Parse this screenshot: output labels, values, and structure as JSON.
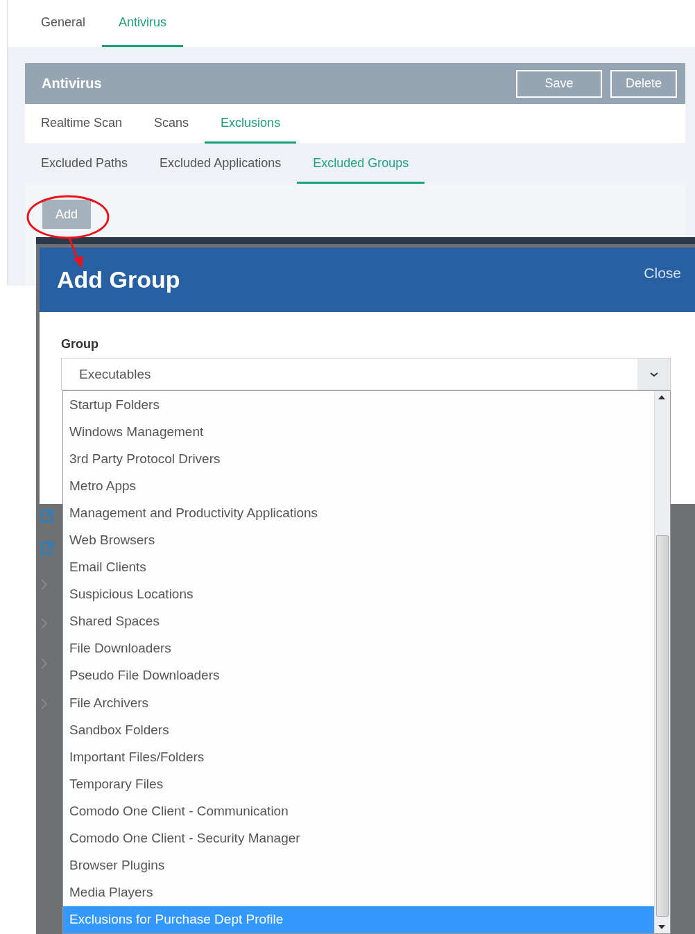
{
  "top_tabs": [
    {
      "label": "General",
      "selected": false
    },
    {
      "label": "Antivirus",
      "selected": true
    }
  ],
  "panel": {
    "title": "Antivirus",
    "buttons": [
      "Save",
      "Delete"
    ]
  },
  "sub_tabs": [
    {
      "label": "Realtime Scan",
      "selected": false
    },
    {
      "label": "Scans",
      "selected": false
    },
    {
      "label": "Exclusions",
      "selected": true
    }
  ],
  "exclusion_tabs": [
    {
      "label": "Excluded Paths",
      "selected": false
    },
    {
      "label": "Excluded Applications",
      "selected": false
    },
    {
      "label": "Excluded Groups",
      "selected": true
    }
  ],
  "add_button": "Add",
  "dialog": {
    "title": "Add Group",
    "close": "Close",
    "field_label": "Group",
    "select_value": "Executables",
    "options": [
      {
        "label": "Startup Folders",
        "selected": false
      },
      {
        "label": "Windows Management",
        "selected": false
      },
      {
        "label": "3rd Party Protocol Drivers",
        "selected": false
      },
      {
        "label": "Metro Apps",
        "selected": false
      },
      {
        "label": "Management and Productivity Applications",
        "selected": false
      },
      {
        "label": "Web Browsers",
        "selected": false
      },
      {
        "label": "Email Clients",
        "selected": false
      },
      {
        "label": "Suspicious Locations",
        "selected": false
      },
      {
        "label": "Shared Spaces",
        "selected": false
      },
      {
        "label": "File Downloaders",
        "selected": false
      },
      {
        "label": "Pseudo File Downloaders",
        "selected": false
      },
      {
        "label": "File Archivers",
        "selected": false
      },
      {
        "label": "Sandbox Folders",
        "selected": false
      },
      {
        "label": "Important Files/Folders",
        "selected": false
      },
      {
        "label": "Temporary Files",
        "selected": false
      },
      {
        "label": "Comodo One Client - Communication",
        "selected": false
      },
      {
        "label": "Comodo One Client - Security Manager",
        "selected": false
      },
      {
        "label": "Browser Plugins",
        "selected": false
      },
      {
        "label": "Media Players",
        "selected": false
      },
      {
        "label": "Exclusions for Purchase Dept Profile",
        "selected": true
      }
    ]
  }
}
